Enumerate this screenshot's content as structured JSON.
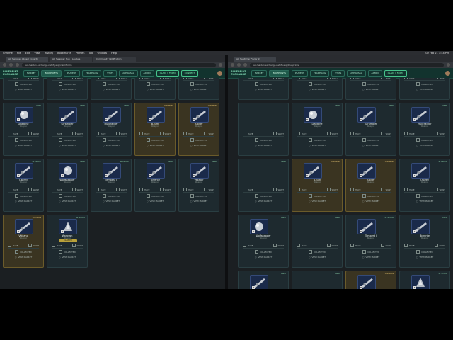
{
  "os_menu": {
    "items": [
      "Chrome",
      "File",
      "Edit",
      "View",
      "History",
      "Bookmarks",
      "Profiles",
      "Tab",
      "Window",
      "Help"
    ],
    "clock": "Tue Feb 21  1:44 PM"
  },
  "browser_left": {
    "tabs": [
      "AC Swaptec Abesal Collecti",
      "AC Swaptec Hub - Loudels",
      "Community Notification"
    ],
    "url": "ac-maiden-exchange.netlify.app/claimforms"
  },
  "browser_right": {
    "tabs": [
      "AC Sealtimer Finder In"
    ],
    "url": "ac-maiden-exchange.netlify.app/blueprints"
  },
  "app_nav": {
    "brand": "BLUEPRINT EXCHANGE",
    "left_buttons": [
      "MARKET",
      "BLUEPRINTS",
      "PLAYERS",
      "TRADE LOG",
      "STATS",
      "APPRAISAL",
      "ADMIN",
      "CLAIM 1 FORM",
      "CONNECT"
    ],
    "right_buttons": [
      "MARKET",
      "BLUEPRINTS",
      "PLAYERS",
      "TRADE LOG",
      "STATS",
      "APPRAISAL",
      "ADMIN",
      "CLAIM 1 FORM"
    ]
  },
  "card_actions": {
    "have": "HAVE",
    "want": "WANT",
    "collected": "COLLECTED",
    "view_market": "VIEW MARKET",
    "rarity": "M",
    "subtitle": "Weapon",
    "claimed_label": "CLAIMED"
  },
  "left_cards": [
    {
      "name": "",
      "badge": "",
      "gold": false,
      "icon": "blank"
    },
    {
      "name": "",
      "badge": "",
      "gold": false,
      "icon": "blank"
    },
    {
      "name": "",
      "badge": "",
      "gold": false,
      "icon": "blank"
    },
    {
      "name": "",
      "badge": "",
      "gold": false,
      "icon": "blank"
    },
    {
      "name": "",
      "badge": "",
      "gold": false,
      "icon": "blank"
    },
    {
      "name": "Deadline",
      "badge": "USED",
      "gold": false,
      "icon": "orb"
    },
    {
      "name": "Scrambler",
      "badge": "USED",
      "gold": false,
      "icon": "rifle"
    },
    {
      "name": "Hullcracker",
      "badge": "USED",
      "gold": false,
      "icon": "rifle"
    },
    {
      "name": "B-Turn",
      "badge": "COMMON",
      "gold": true,
      "icon": "rifle"
    },
    {
      "name": "Jupiter",
      "badge": "COMMON",
      "gold": true,
      "icon": "rifle"
    },
    {
      "name": "Osprey",
      "badge": "IN STOCK",
      "gold": false,
      "icon": "rifle"
    },
    {
      "name": "Wolfsnapper",
      "badge": "USED",
      "gold": false,
      "icon": "orb"
    },
    {
      "name": "Tempest I",
      "badge": "IN STOCK",
      "gold": false,
      "icon": "rifle"
    },
    {
      "name": "Torrente",
      "badge": "USED",
      "gold": false,
      "icon": "rifle"
    },
    {
      "name": "Vexator",
      "badge": "USED",
      "gold": false,
      "icon": "rifle"
    },
    {
      "name": "Vulcano",
      "badge": "COMMON",
      "gold": true,
      "icon": "rifle"
    },
    {
      "name": "Warbush",
      "badge": "IN STOCK",
      "gold": false,
      "icon": "spike",
      "claimed": true
    }
  ],
  "right_cards": [
    {
      "name": "",
      "badge": "",
      "gold": false,
      "icon": "blank"
    },
    {
      "name": "",
      "badge": "",
      "gold": false,
      "icon": "blank"
    },
    {
      "name": "",
      "badge": "",
      "gold": false,
      "icon": "blank"
    },
    {
      "name": "",
      "badge": "",
      "gold": false,
      "icon": "blank"
    },
    {
      "name": "",
      "badge": "",
      "gold": false,
      "icon": "blank"
    },
    {
      "name": "Deadline",
      "badge": "USED",
      "gold": false,
      "icon": "orb"
    },
    {
      "name": "Scrambler",
      "badge": "USED",
      "gold": false,
      "icon": "rifle"
    },
    {
      "name": "Hullcracker",
      "badge": "USED",
      "gold": false,
      "icon": "rifle"
    },
    {
      "name": "",
      "badge": "USED",
      "gold": false,
      "icon": "blank"
    },
    {
      "name": "B-Turn",
      "badge": "COMMON",
      "gold": true,
      "icon": "rifle"
    },
    {
      "name": "Jupiter",
      "badge": "COMMON",
      "gold": true,
      "icon": "rifle"
    },
    {
      "name": "Osprey",
      "badge": "IN STOCK",
      "gold": false,
      "icon": "rifle"
    },
    {
      "name": "Wolfsnapper",
      "badge": "USED",
      "gold": false,
      "icon": "orb"
    },
    {
      "name": "",
      "badge": "USED",
      "gold": false,
      "icon": "blank"
    },
    {
      "name": "Tempest I",
      "badge": "IN STOCK",
      "gold": false,
      "icon": "rifle"
    },
    {
      "name": "Torrente",
      "badge": "USED",
      "gold": false,
      "icon": "rifle"
    },
    {
      "name": "Vexator",
      "badge": "USED",
      "gold": false,
      "icon": "rifle"
    },
    {
      "name": "",
      "badge": "USED",
      "gold": false,
      "icon": "blank"
    },
    {
      "name": "Vulcano",
      "badge": "COMMON",
      "gold": true,
      "icon": "rifle"
    },
    {
      "name": "Warbush",
      "badge": "IN STOCK",
      "gold": false,
      "icon": "spike",
      "claimed": true
    }
  ],
  "colors": {
    "nav_bg": "#12332e",
    "card_bg": "#1e2a2f",
    "gold_card_bg": "#3a3421",
    "claimed": "#b9a13b"
  }
}
